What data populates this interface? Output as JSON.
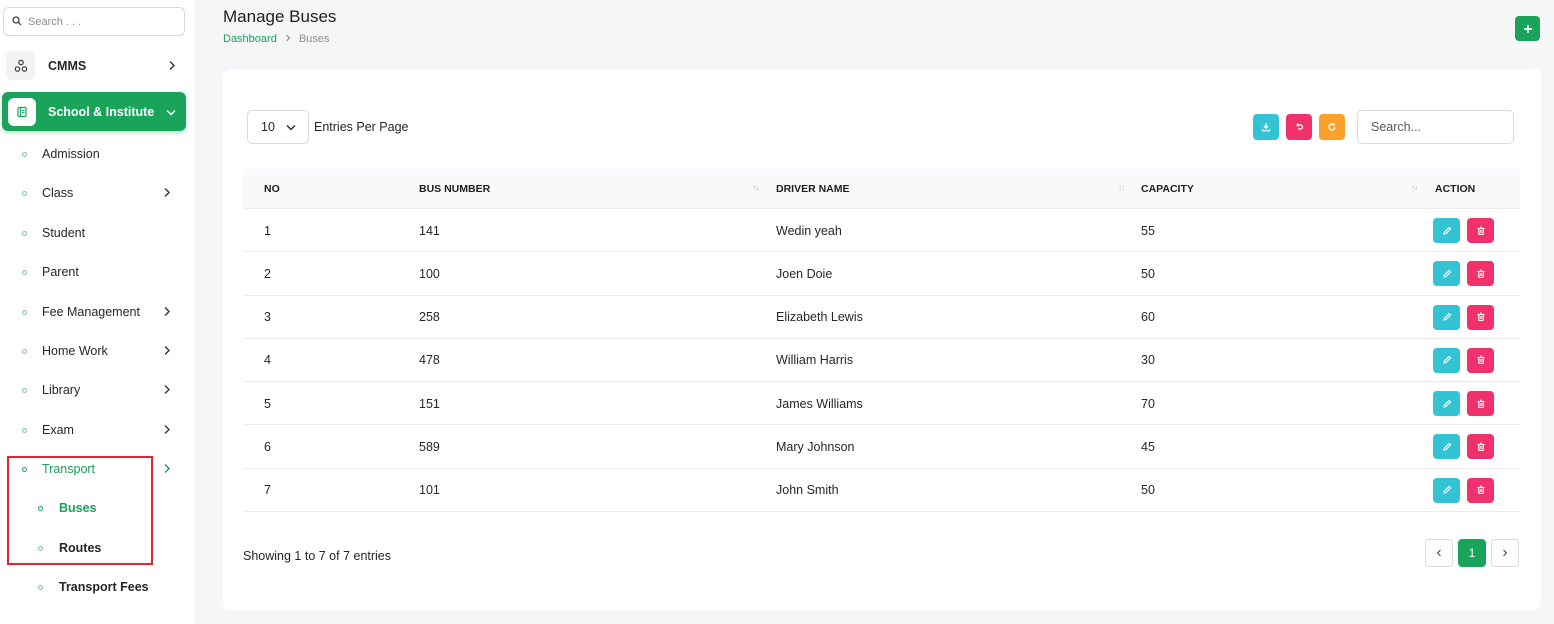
{
  "sidebar": {
    "search_placeholder": "Search . . .",
    "cmms_label": "CMMS",
    "school_label": "School & Institute",
    "items": [
      {
        "label": "Admission",
        "has_chevron": false
      },
      {
        "label": "Class",
        "has_chevron": true
      },
      {
        "label": "Student",
        "has_chevron": false
      },
      {
        "label": "Parent",
        "has_chevron": false
      },
      {
        "label": "Fee Management",
        "has_chevron": true
      },
      {
        "label": "Home Work",
        "has_chevron": true
      },
      {
        "label": "Library",
        "has_chevron": true
      },
      {
        "label": "Exam",
        "has_chevron": true
      },
      {
        "label": "Transport",
        "has_chevron": true,
        "active": true
      }
    ],
    "transport_children": [
      {
        "label": "Buses",
        "active": true
      },
      {
        "label": "Routes",
        "active": false
      },
      {
        "label": "Transport Fees",
        "active": false
      }
    ]
  },
  "header": {
    "title": "Manage Buses",
    "breadcrumb_home": "Dashboard",
    "breadcrumb_current": "Buses"
  },
  "toolbar": {
    "entries_value": "10",
    "entries_label": "Entries Per Page",
    "search_placeholder": "Search..."
  },
  "table": {
    "columns": [
      "NO",
      "BUS NUMBER",
      "DRIVER NAME",
      "CAPACITY",
      "ACTION"
    ],
    "rows": [
      {
        "no": "1",
        "bus_number": "141",
        "driver": "Wedin yeah",
        "capacity": "55"
      },
      {
        "no": "2",
        "bus_number": "100",
        "driver": "Joen Doie",
        "capacity": "50"
      },
      {
        "no": "3",
        "bus_number": "258",
        "driver": "Elizabeth Lewis",
        "capacity": "60"
      },
      {
        "no": "4",
        "bus_number": "478",
        "driver": "William Harris",
        "capacity": "30"
      },
      {
        "no": "5",
        "bus_number": "151",
        "driver": "James Williams",
        "capacity": "70"
      },
      {
        "no": "6",
        "bus_number": "589",
        "driver": "Mary Johnson",
        "capacity": "45"
      },
      {
        "no": "7",
        "bus_number": "101",
        "driver": "John Smith",
        "capacity": "50"
      }
    ]
  },
  "footer": {
    "showing_text": "Showing 1 to 7 of 7 entries",
    "current_page": "1"
  },
  "colors": {
    "brand_green": "#1aa35a",
    "cyan": "#34c2d5",
    "pink": "#f0316b",
    "orange": "#f9a12b",
    "highlight_red": "#e0262e"
  }
}
